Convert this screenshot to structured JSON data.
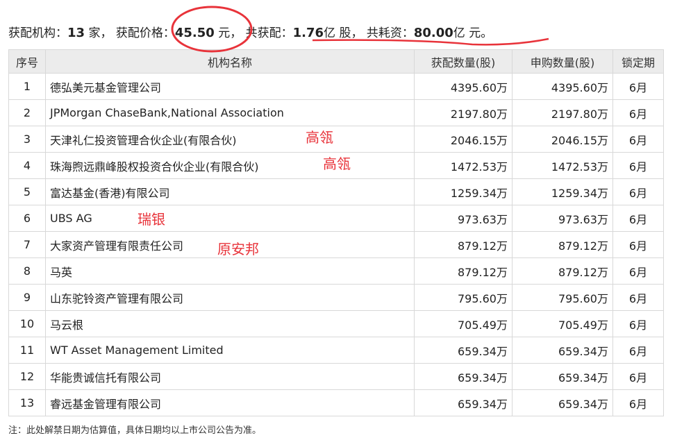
{
  "summary": {
    "l1": "获配机构：",
    "count": "13",
    "u1": "家，  获配价格：",
    "price": "45.50",
    "u2": "元，  共获配：",
    "shares": "1.76",
    "u3": "亿 股，  共耗资：",
    "amount": "80.00",
    "u4": "亿 元。"
  },
  "headers": [
    "序号",
    "机构名称",
    "获配数量(股)",
    "申购数量(股)",
    "锁定期"
  ],
  "rows": [
    [
      "1",
      "德弘美元基金管理公司",
      "4395.60万",
      "4395.60万",
      "6月"
    ],
    [
      "2",
      "JPMorgan ChaseBank,National Association",
      "2197.80万",
      "2197.80万",
      "6月"
    ],
    [
      "3",
      "天津礼仁投资管理合伙企业(有限合伙)",
      "2046.15万",
      "2046.15万",
      "6月"
    ],
    [
      "4",
      "珠海煦远鼎峰股权投资合伙企业(有限合伙)",
      "1472.53万",
      "1472.53万",
      "6月"
    ],
    [
      "5",
      "富达基金(香港)有限公司",
      "1259.34万",
      "1259.34万",
      "6月"
    ],
    [
      "6",
      "UBS AG",
      "973.63万",
      "973.63万",
      "6月"
    ],
    [
      "7",
      "大家资产管理有限责任公司",
      "879.12万",
      "879.12万",
      "6月"
    ],
    [
      "8",
      "马英",
      "879.12万",
      "879.12万",
      "6月"
    ],
    [
      "9",
      "山东驼铃资产管理有限公司",
      "795.60万",
      "795.60万",
      "6月"
    ],
    [
      "10",
      "马云根",
      "705.49万",
      "705.49万",
      "6月"
    ],
    [
      "11",
      "WT Asset Management Limited",
      "659.34万",
      "659.34万",
      "6月"
    ],
    [
      "12",
      "华能贵诚信托有限公司",
      "659.34万",
      "659.34万",
      "6月"
    ],
    [
      "13",
      "睿远基金管理有限公司",
      "659.34万",
      "659.34万",
      "6月"
    ]
  ],
  "note": "注：此处解禁日期为估算值，具体日期均以上市公司公告为准。",
  "annotations": [
    "高瓴",
    "高瓴",
    "瑞银",
    "原安邦"
  ],
  "colors": {
    "annotation": "#e8333a"
  }
}
